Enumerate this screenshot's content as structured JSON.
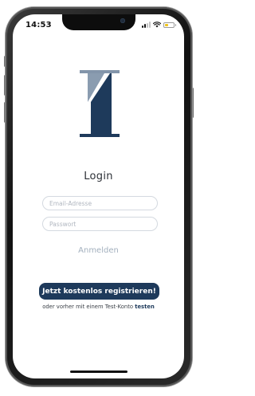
{
  "status_bar": {
    "time": "14:53",
    "signal_icon": "signal-bars-icon",
    "wifi_icon": "wifi-icon",
    "battery_icon": "battery-icon",
    "battery_level": 0.35
  },
  "logo": {
    "icon": "brand-logo-icon",
    "colors": {
      "dark": "#1e3a5b",
      "light": "#8395aa"
    }
  },
  "login": {
    "title": "Login",
    "email_placeholder": "Email-Adresse",
    "password_placeholder": "Passwort",
    "signin_label": "Anmelden"
  },
  "register": {
    "button_label": "Jetzt kostenlos registrieren!",
    "test_prefix": "oder vorher mit einem Test-Konto",
    "test_link": "testen"
  },
  "colors": {
    "primary": "#1e3a5b",
    "muted_link": "#a3b0be",
    "field_border": "#d4d9e0"
  }
}
